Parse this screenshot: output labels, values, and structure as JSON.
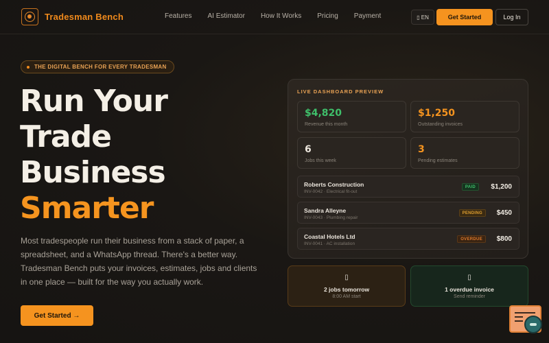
{
  "nav": {
    "brand": "Tradesman Bench",
    "links": [
      "Features",
      "AI Estimator",
      "How It Works",
      "Pricing",
      "Payment"
    ],
    "lang_icon": "▯",
    "lang": "EN",
    "cta": "Get Started",
    "login": "Log In"
  },
  "hero": {
    "badge": "THE DIGITAL BENCH FOR EVERY TRADESMAN",
    "title_lines": [
      "Run Your",
      "Trade",
      "Business"
    ],
    "title_accent": "Smarter",
    "description": "Most tradespeople run their business from a stack of paper, a spreadsheet, and a WhatsApp thread. There's a better way. Tradesman Bench puts your invoices, estimates, jobs and clients in one place — built for the way you actually work.",
    "cta": "Get Started →"
  },
  "dashboard": {
    "label": "LIVE DASHBOARD PREVIEW",
    "stats": [
      {
        "value": "$4,820",
        "label": "Revenue this month",
        "color": "#3fbf6a"
      },
      {
        "value": "$1,250",
        "label": "Outstanding invoices",
        "color": "#f5941f"
      },
      {
        "value": "6",
        "label": "Jobs this week",
        "color": "#ece6dd"
      },
      {
        "value": "3",
        "label": "Pending estimates",
        "color": "#f5941f"
      }
    ],
    "invoices": [
      {
        "name": "Roberts Construction",
        "sub": "INV-0042 · Electrical fit-out",
        "status": "PAID",
        "amount": "$1,200"
      },
      {
        "name": "Sandra Alleyne",
        "sub": "INV-0043 · Plumbing repair",
        "status": "PENDING",
        "amount": "$450"
      },
      {
        "name": "Coastal Hotels Ltd",
        "sub": "INV-0041 · AC installation",
        "status": "OVERDUE",
        "amount": "$800"
      }
    ]
  },
  "notifications": [
    {
      "icon": "▯",
      "title": "2 jobs tomorrow",
      "sub": "8:00 AM start"
    },
    {
      "icon": "▯",
      "title": "1 overdue invoice",
      "sub": "Send reminder"
    }
  ],
  "colors": {
    "accent": "#f5941f",
    "revenue": "#3fbf6a",
    "paid": "#3fbf6a",
    "pending": "#e0a030",
    "overdue": "#e07a2a"
  }
}
